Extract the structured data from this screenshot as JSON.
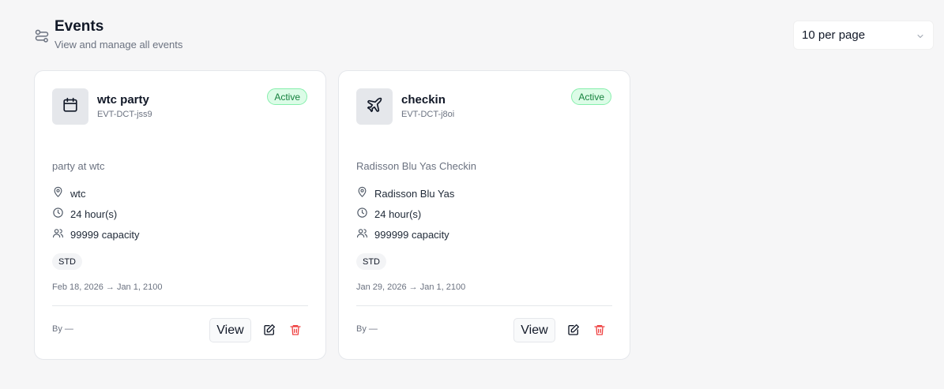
{
  "header": {
    "title": "Events",
    "subtitle": "View and manage all events",
    "icon": "settings-route-icon"
  },
  "pagination": {
    "per_page_label": "10 per page"
  },
  "events": [
    {
      "name": "wtc party",
      "code": "EVT-DCT-jss9",
      "status": "Active",
      "icon": "calendar-icon",
      "description": "party at wtc",
      "location": "wtc",
      "duration": "24 hour(s)",
      "capacity": "99999 capacity",
      "tag": "STD",
      "dates": "Feb 18, 2026 → Jan 1, 2100",
      "by": "By —",
      "view_label": "View"
    },
    {
      "name": "checkin",
      "code": "EVT-DCT-j8oi",
      "status": "Active",
      "icon": "plane-icon",
      "description": "Radisson Blu Yas Checkin",
      "location": "Radisson Blu Yas",
      "duration": "24 hour(s)",
      "capacity": "999999 capacity",
      "tag": "STD",
      "dates": "Jan 29, 2026 → Jan 1, 2100",
      "by": "By —",
      "view_label": "View"
    }
  ],
  "colors": {
    "background": "#f6f6f7",
    "active_badge_bg": "#dcfce7",
    "active_badge_text": "#15803d",
    "delete": "#ef4444"
  }
}
